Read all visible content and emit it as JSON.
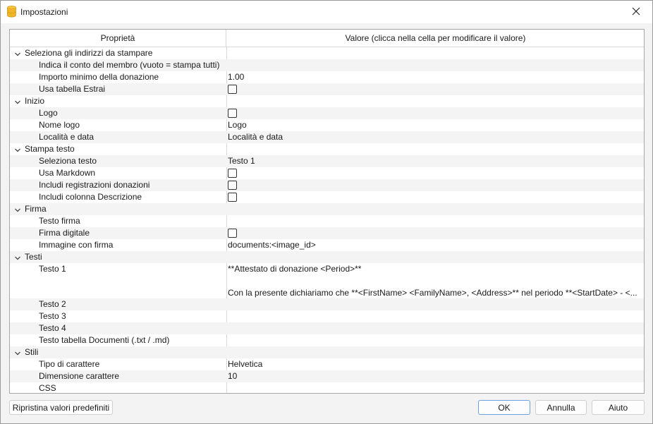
{
  "window": {
    "title": "Impostazioni",
    "app_icon": "database-icon",
    "close_icon": "close-icon"
  },
  "grid": {
    "header": {
      "property": "Proprietà",
      "value": "Valore (clicca nella cella per modificare il valore)"
    },
    "rows": [
      {
        "type": "group",
        "label": "Seleziona gli indirizzi da stampare",
        "expanded": true
      },
      {
        "type": "child",
        "label": "Indica il conto del membro (vuoto = stampa tutti)",
        "value": ""
      },
      {
        "type": "child",
        "label": "Importo minimo della donazione",
        "value": "1.00"
      },
      {
        "type": "child",
        "label": "Usa tabella Estrai",
        "checkbox": true,
        "checked": false
      },
      {
        "type": "group",
        "label": "Inizio",
        "expanded": true
      },
      {
        "type": "child",
        "label": "Logo",
        "checkbox": true,
        "checked": false
      },
      {
        "type": "child",
        "label": "Nome logo",
        "value": "Logo"
      },
      {
        "type": "child",
        "label": "Località e data",
        "value": "Località e data"
      },
      {
        "type": "group",
        "label": "Stampa testo",
        "expanded": true
      },
      {
        "type": "child",
        "label": "Seleziona testo",
        "value": "Testo 1"
      },
      {
        "type": "child",
        "label": "Usa Markdown",
        "checkbox": true,
        "checked": false
      },
      {
        "type": "child",
        "label": "Includi registrazioni donazioni",
        "checkbox": true,
        "checked": false
      },
      {
        "type": "child",
        "label": "Includi colonna Descrizione",
        "checkbox": true,
        "checked": false
      },
      {
        "type": "group",
        "label": "Firma",
        "expanded": true
      },
      {
        "type": "child",
        "label": "Testo firma",
        "value": ""
      },
      {
        "type": "child",
        "label": "Firma digitale",
        "checkbox": true,
        "checked": false
      },
      {
        "type": "child",
        "label": "Immagine con firma",
        "value": "documents:<image_id>"
      },
      {
        "type": "group",
        "label": "Testi",
        "expanded": true
      },
      {
        "type": "child",
        "label": "Testo 1",
        "multiline": true,
        "lines": [
          "**Attestato di donazione <Period>**",
          "",
          "Con la presente dichiariamo che **<FirstName> <FamilyName>, <Address>** nel periodo **<StartDate> - <..."
        ]
      },
      {
        "type": "child",
        "label": "Testo 2",
        "value": ""
      },
      {
        "type": "child",
        "label": "Testo 3",
        "value": ""
      },
      {
        "type": "child",
        "label": "Testo 4",
        "value": ""
      },
      {
        "type": "child",
        "label": "Testo tabella Documenti (.txt / .md)",
        "value": ""
      },
      {
        "type": "group",
        "label": "Stili",
        "expanded": true
      },
      {
        "type": "child",
        "label": "Tipo di carattere",
        "value": "Helvetica"
      },
      {
        "type": "child",
        "label": "Dimensione carattere",
        "value": "10"
      },
      {
        "type": "child",
        "label": "CSS",
        "value": ""
      }
    ]
  },
  "buttons": {
    "reset": "Ripristina valori predefiniti",
    "ok": "OK",
    "cancel": "Annulla",
    "help": "Aiuto"
  },
  "colors": {
    "accent_border": "#6aa0e0",
    "app_icon_top": "#f7c948",
    "app_icon_body": "#f0b429"
  }
}
